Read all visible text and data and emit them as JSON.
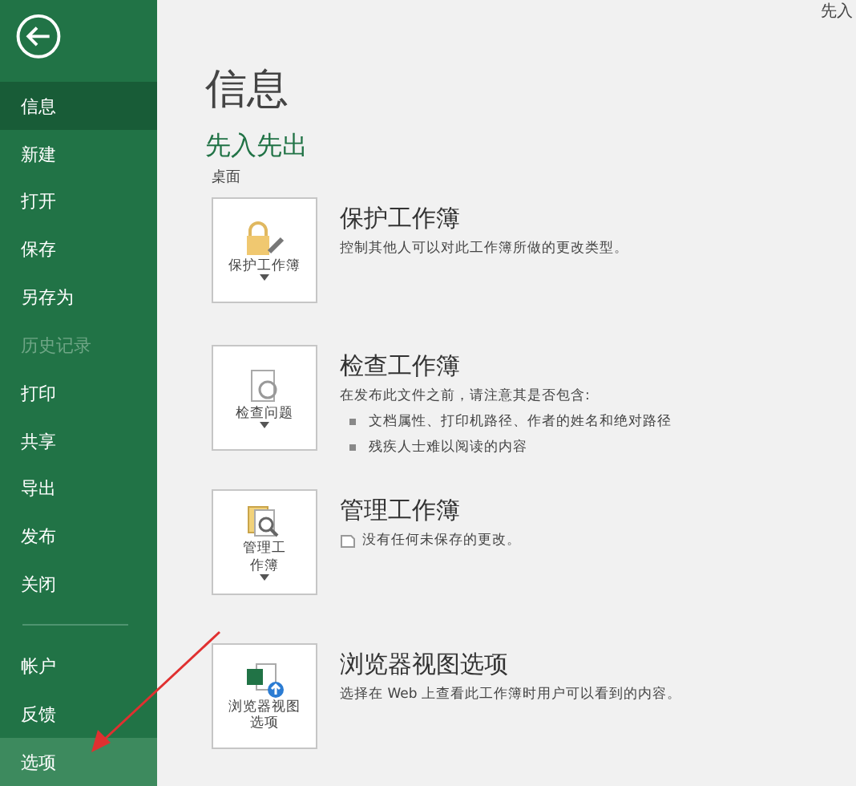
{
  "sidebar": {
    "items": [
      {
        "label": "信息",
        "selected": true,
        "disabled": false
      },
      {
        "label": "新建",
        "selected": false,
        "disabled": false
      },
      {
        "label": "打开",
        "selected": false,
        "disabled": false
      },
      {
        "label": "保存",
        "selected": false,
        "disabled": false
      },
      {
        "label": "另存为",
        "selected": false,
        "disabled": false
      },
      {
        "label": "历史记录",
        "selected": false,
        "disabled": true
      },
      {
        "label": "打印",
        "selected": false,
        "disabled": false
      },
      {
        "label": "共享",
        "selected": false,
        "disabled": false
      },
      {
        "label": "导出",
        "selected": false,
        "disabled": false
      },
      {
        "label": "发布",
        "selected": false,
        "disabled": false
      },
      {
        "label": "关闭",
        "selected": false,
        "disabled": false
      }
    ],
    "bottom_items": [
      {
        "label": "帐户",
        "selected": false,
        "disabled": false
      },
      {
        "label": "反馈",
        "selected": false,
        "disabled": false
      },
      {
        "label": "选项",
        "selected": true,
        "disabled": false
      }
    ]
  },
  "top_right": "先入",
  "page": {
    "title": "信息",
    "file_name": "先入先出",
    "file_location": "桌面"
  },
  "sections": [
    {
      "kind": "protect",
      "button_lines": [
        "保护工作簿"
      ],
      "dropdown": true,
      "heading": "保护工作簿",
      "description": [
        "控制其他人可以对此工作簿所做的更改类型。"
      ]
    },
    {
      "kind": "inspect",
      "button_lines": [
        "检查问题"
      ],
      "dropdown": true,
      "heading": "检查工作簿",
      "description": [
        "在发布此文件之前，请注意其是否包含:"
      ],
      "bullets": [
        "文档属性、打印机路径、作者的姓名和绝对路径",
        "残疾人士难以阅读的内容"
      ]
    },
    {
      "kind": "manage",
      "button_lines": [
        "管理工",
        "作簿"
      ],
      "dropdown": true,
      "heading": "管理工作簿",
      "description": [
        "没有任何未保存的更改。"
      ],
      "note_icon": true
    },
    {
      "kind": "browser",
      "button_lines": [
        "浏览器视图",
        "选项"
      ],
      "dropdown": false,
      "heading": "浏览器视图选项",
      "description": [
        "选择在 Web 上查看此工作簿时用户可以看到的内容。"
      ]
    }
  ]
}
